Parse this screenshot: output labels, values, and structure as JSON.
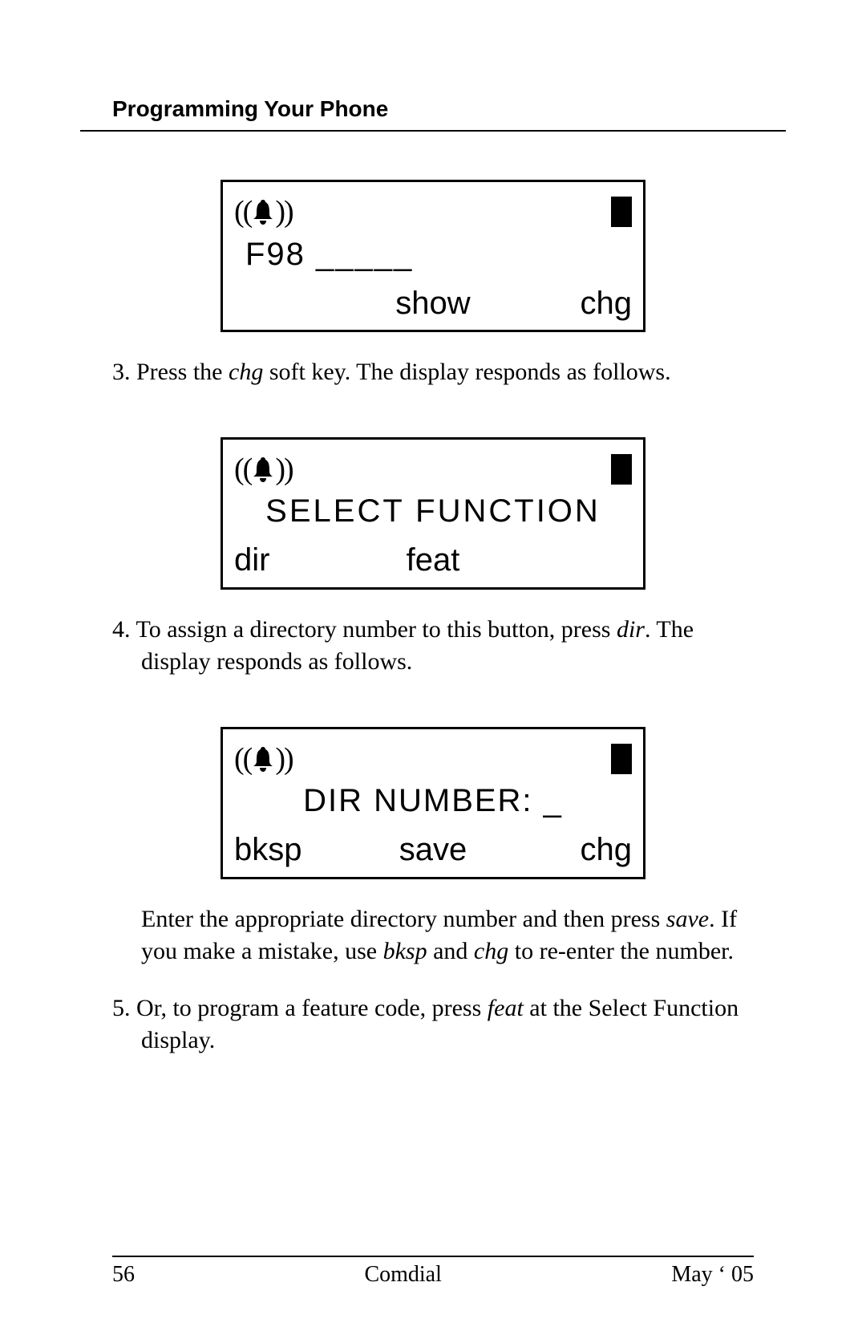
{
  "header": {
    "section_title": "Programming Your Phone"
  },
  "display1": {
    "line2": "F98 _____",
    "sk_left": "",
    "sk_center": "show",
    "sk_right": "chg"
  },
  "step3": {
    "num": "3.",
    "before": "Press the ",
    "em": "chg",
    "after": " soft key.  The display responds as follows."
  },
  "display2": {
    "line2": "SELECT FUNCTION",
    "sk_left": "dir",
    "sk_center": "feat",
    "sk_right": ""
  },
  "step4": {
    "num": "4.",
    "before": "To assign a directory number to this button, press ",
    "em": "dir",
    "after": ".  The display responds as follows."
  },
  "display3": {
    "line2": "DIR NUMBER: _",
    "sk_left": "bksp",
    "sk_center": "save",
    "sk_right": "chg"
  },
  "para_post_d3_a": "Enter the appropriate directory number and then press ",
  "para_post_d3_save": "save",
  "para_post_d3_b": ".  If you make a mistake, use ",
  "para_post_d3_bksp": "bksp",
  "para_post_d3_c": " and ",
  "para_post_d3_chg": "chg",
  "para_post_d3_d": " to re-enter the number.",
  "step5": {
    "num": "5.",
    "before": "Or, to program a feature code, press ",
    "em": "feat",
    "after": " at the Select Function display."
  },
  "footer": {
    "page": "56",
    "brand": "Comdial",
    "date": "May ‘ 05"
  },
  "icons": {
    "bell": "bell-icon",
    "cursor": "cursor-block"
  }
}
